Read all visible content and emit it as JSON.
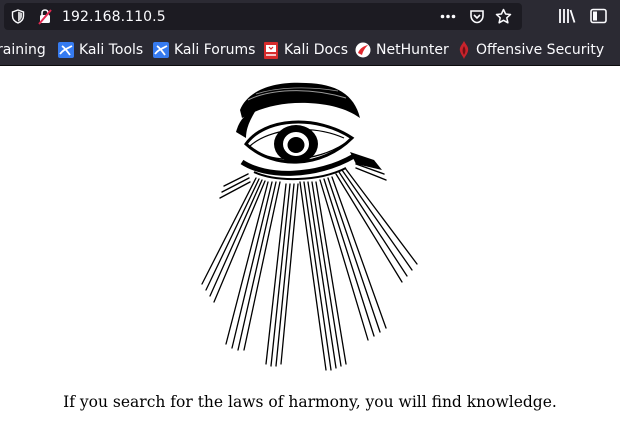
{
  "browser": {
    "url": "192.168.110.5",
    "toolbar_icons": [
      "shield-icon",
      "insecure-lock-icon",
      "page-actions-icon",
      "pocket-icon",
      "bookmark-star-icon",
      "library-icon",
      "sidebar-icon"
    ]
  },
  "bookmarks": [
    {
      "label": "raining",
      "icon": "none"
    },
    {
      "label": "Kali Tools",
      "icon": "kali-dragon-icon"
    },
    {
      "label": "Kali Forums",
      "icon": "kali-dragon-icon"
    },
    {
      "label": "Kali Docs",
      "icon": "kali-docs-icon"
    },
    {
      "label": "NetHunter",
      "icon": "nethunter-icon"
    },
    {
      "label": "Offensive Security",
      "icon": "offsec-icon"
    }
  ],
  "page": {
    "caption": "If you search for the laws of harmony, you will find knowledge."
  },
  "colors": {
    "toolbar_bg": "#2b2a33",
    "urlbar_bg": "#1c1b22",
    "text_light": "#fbfbfe",
    "page_bg": "#ffffff"
  }
}
